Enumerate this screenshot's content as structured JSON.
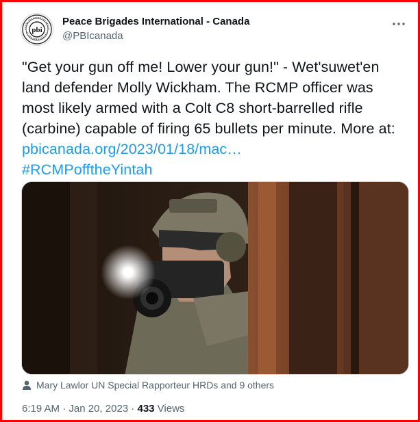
{
  "author": {
    "display_name": "Peace Brigades International - Canada",
    "handle": "@PBIcanada",
    "avatar_text": "pbi"
  },
  "tweet": {
    "text_plain": "\"Get your gun off me! Lower your gun!\" - Wet'suwet'en land defender Molly Wickham. The RCMP officer was most likely armed with a Colt C8 short-barrelled rifle (carbine) capable of firing 65 bullets per minute. More at: ",
    "link_text": "pbicanada.org/2023/01/18/mac…",
    "hashtag": "#RCMPofftheYintah"
  },
  "media": {
    "icon": "photo"
  },
  "tagged": {
    "icon": "person-icon",
    "text": "Mary Lawlor UN Special Rapporteur HRDs and 9 others"
  },
  "meta": {
    "time": "6:19 AM",
    "separator1": " · ",
    "date": "Jan 20, 2023",
    "separator2": " · ",
    "views_count": "433",
    "views_label": " Views"
  },
  "colors": {
    "frame_border": "#ff0000",
    "link": "#1d9bf0",
    "secondary_text": "#536471",
    "primary_text": "#0f1419"
  }
}
